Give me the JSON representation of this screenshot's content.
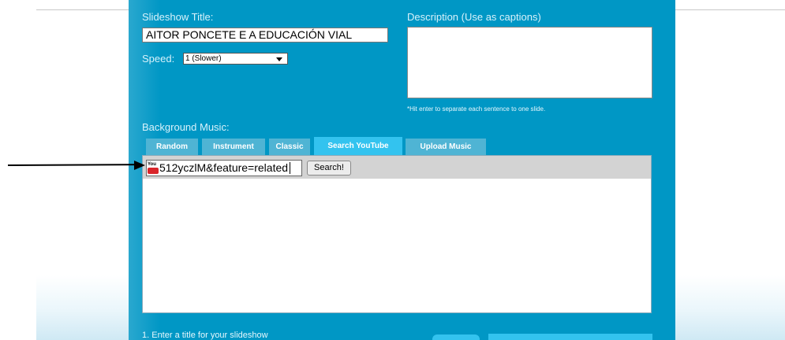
{
  "form": {
    "slideshow_title_label": "Slideshow Title:",
    "slideshow_title_value": "AITOR PONCETE E A EDUCACIÓN VIAL",
    "speed_label": "Speed:",
    "speed_value": "1 (Slower)",
    "description_label": "Description (Use as captions)",
    "description_value": "",
    "description_hint": "*Hit enter to separate each sentence to one slide.",
    "background_music_label": "Background Music:"
  },
  "music_tabs": [
    {
      "label": "Random"
    },
    {
      "label": "Instrument"
    },
    {
      "label": "Classic"
    },
    {
      "label": "Search YouTube",
      "active": true
    },
    {
      "label": "Upload Music"
    }
  ],
  "youtube_search": {
    "query_value": "512yczlM&feature=related",
    "button_label": "Search!",
    "icon": "youtube-icon"
  },
  "steps": {
    "step1": "1. Enter a title for your slideshow"
  },
  "colors": {
    "panel": "#0097c5",
    "active_tab": "#33c3ef",
    "tab": "#4fb4d4"
  }
}
